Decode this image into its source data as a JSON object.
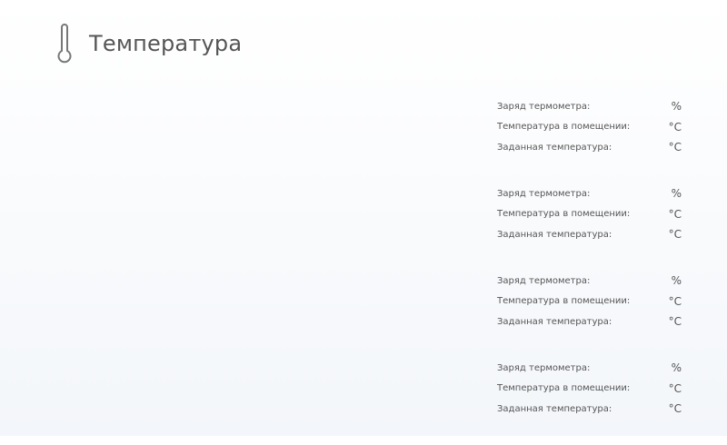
{
  "header": {
    "title": "Температура",
    "icon": "thermometer-icon"
  },
  "sensors": [
    {
      "charge_label": "Заряд термометра:",
      "charge_unit": "%",
      "room_temp_label": "Температура в помещении:",
      "room_temp_unit": "°C",
      "target_temp_label": "Заданная температура:",
      "target_temp_unit": "°C"
    },
    {
      "charge_label": "Заряд термометра:",
      "charge_unit": "%",
      "room_temp_label": "Температура в помещении:",
      "room_temp_unit": "°C",
      "target_temp_label": "Заданная температура:",
      "target_temp_unit": "°C"
    },
    {
      "charge_label": "Заряд термометра:",
      "charge_unit": "%",
      "room_temp_label": "Температура в помещении:",
      "room_temp_unit": "°C",
      "target_temp_label": "Заданная температура:",
      "target_temp_unit": "°C"
    },
    {
      "charge_label": "Заряд термометра:",
      "charge_unit": "%",
      "room_temp_label": "Температура в помещении:",
      "room_temp_unit": "°C",
      "target_temp_label": "Заданная температура:",
      "target_temp_unit": "°C"
    }
  ],
  "colors": {
    "text": "#555555",
    "background_top": "#ffffff",
    "background_bottom": "#f3f6fa"
  }
}
